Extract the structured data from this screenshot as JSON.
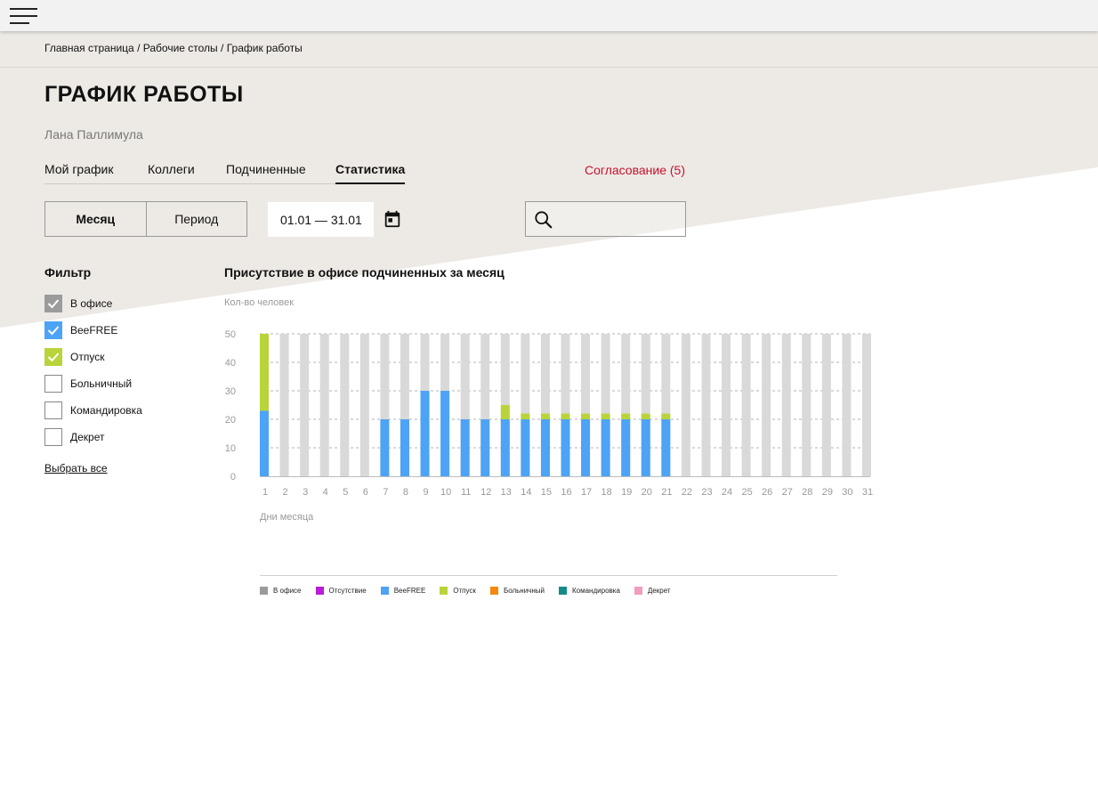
{
  "breadcrumb": {
    "home": "Главная страница",
    "sep": " / ",
    "desks": "Рабочие столы",
    "current": "График работы"
  },
  "page": {
    "title": "ГРАФИК РАБОТЫ",
    "user": "Лана Паллимула"
  },
  "tabs": [
    {
      "label": "Мой график",
      "active": false
    },
    {
      "label": "Коллеги",
      "active": false
    },
    {
      "label": "Подчиненные",
      "active": false
    },
    {
      "label": "Статистика",
      "active": true
    }
  ],
  "approval_label": "Согласование (5)",
  "mode": {
    "month": "Месяц",
    "period": "Период",
    "selected": "month"
  },
  "date_range": "01.01 — 31.01",
  "search": {
    "value": "",
    "placeholder": ""
  },
  "filter": {
    "title": "Фильтр",
    "items": [
      {
        "label": "В офисе",
        "checked": true,
        "color": "#9b9b9b"
      },
      {
        "label": "BeeFREE",
        "checked": true,
        "color": "#4da3f5"
      },
      {
        "label": "Отпуск",
        "checked": true,
        "color": "#b8d43a"
      },
      {
        "label": "Больничный",
        "checked": false,
        "color": ""
      },
      {
        "label": "Командировка",
        "checked": false,
        "color": ""
      },
      {
        "label": "Декрет",
        "checked": false,
        "color": ""
      }
    ],
    "select_all": "Выбрать все"
  },
  "chart": {
    "title": "Присутствие в офисе подчиненных за месяц",
    "ylabel": "Кол-во человек",
    "xlabel": "Дни месяца"
  },
  "legend": [
    {
      "label": "В офисе",
      "color": "#9b9b9b"
    },
    {
      "label": "Отсутствие",
      "color": "#b81ed6"
    },
    {
      "label": "BeeFREE",
      "color": "#4da3f5"
    },
    {
      "label": "Отпуск",
      "color": "#b8d43a"
    },
    {
      "label": "Больничный",
      "color": "#f5890f"
    },
    {
      "label": "Командировка",
      "color": "#158a8a"
    },
    {
      "label": "Декрет",
      "color": "#f29cbf"
    }
  ],
  "colors": {
    "accent_red": "#c8102e",
    "bar_background": "#d9d9d9",
    "page_bg": "#edeae5"
  },
  "chart_data": {
    "type": "bar",
    "stacked": true,
    "title": "Присутствие в офисе подчиненных за месяц",
    "xlabel": "Дни месяца",
    "ylabel": "Кол-во человек",
    "ylim": [
      0,
      50
    ],
    "yticks": [
      0,
      10,
      20,
      30,
      40,
      50
    ],
    "grid": true,
    "categories": [
      "1",
      "2",
      "3",
      "4",
      "5",
      "6",
      "7",
      "8",
      "9",
      "10",
      "11",
      "12",
      "13",
      "14",
      "15",
      "16",
      "17",
      "18",
      "19",
      "20",
      "21",
      "22",
      "23",
      "24",
      "25",
      "26",
      "27",
      "28",
      "29",
      "30",
      "31"
    ],
    "series": [
      {
        "name": "BeeFREE",
        "color": "#4da3f5",
        "values": [
          23,
          0,
          0,
          0,
          0,
          0,
          20,
          20,
          30,
          30,
          20,
          20,
          20,
          20,
          20,
          20,
          20,
          20,
          20,
          20,
          20,
          0,
          0,
          0,
          0,
          0,
          0,
          0,
          0,
          0,
          0
        ]
      },
      {
        "name": "Отпуск",
        "color": "#b8d43a",
        "values": [
          27,
          0,
          0,
          0,
          0,
          0,
          0,
          0,
          0,
          0,
          0,
          0,
          5,
          2,
          2,
          2,
          2,
          2,
          2,
          2,
          2,
          0,
          0,
          0,
          0,
          0,
          0,
          0,
          0,
          0,
          0
        ]
      }
    ],
    "background_total": 50
  }
}
